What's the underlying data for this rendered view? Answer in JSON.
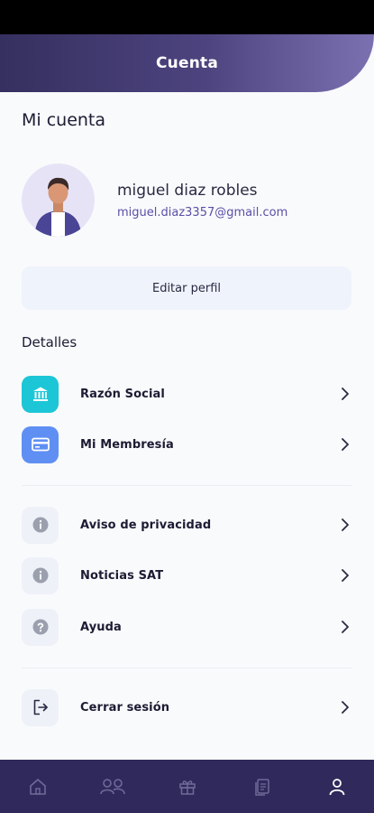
{
  "header": {
    "title": "Cuenta"
  },
  "account": {
    "title": "Mi cuenta",
    "name": "miguel diaz robles",
    "email": "miguel.diaz3357@gmail.com",
    "edit_label": "Editar perfil"
  },
  "details": {
    "title": "Detalles",
    "items": [
      {
        "label": "Razón Social",
        "icon": "bank-icon"
      },
      {
        "label": "Mi Membresía",
        "icon": "card-icon"
      }
    ]
  },
  "info": {
    "items": [
      {
        "label": "Aviso de privacidad",
        "icon": "info-icon"
      },
      {
        "label": "Noticias SAT",
        "icon": "info-icon"
      },
      {
        "label": "Ayuda",
        "icon": "help-icon"
      }
    ]
  },
  "logout": {
    "label": "Cerrar sesión",
    "icon": "logout-icon"
  },
  "nav": {
    "items": [
      "home-icon",
      "users-icon",
      "gift-icon",
      "documents-icon",
      "profile-icon"
    ],
    "active": "profile-icon"
  },
  "colors": {
    "header_start": "#35305f",
    "header_end": "#7b71b1",
    "nav_bg": "#2f2a5b",
    "email": "#5a4fa6",
    "teal": "#1cc6d6",
    "blue": "#5f8ff3"
  }
}
